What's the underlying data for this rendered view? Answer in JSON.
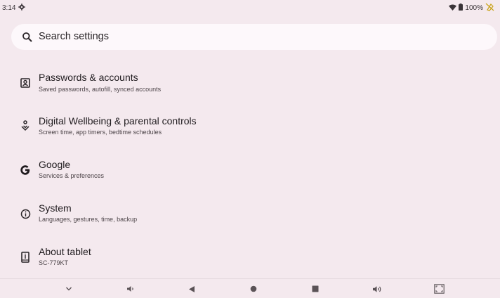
{
  "status": {
    "time": "3:14",
    "battery": "100%",
    "icons": [
      "settings-gear-icon",
      "wifi-icon",
      "battery-icon",
      "no-sim-icon"
    ]
  },
  "search": {
    "placeholder": "Search settings"
  },
  "settings": [
    {
      "title": "Passwords & accounts",
      "subtitle": "Saved passwords, autofill, synced accounts",
      "icon": "account-box-icon"
    },
    {
      "title": "Digital Wellbeing & parental controls",
      "subtitle": "Screen time, app timers, bedtime schedules",
      "icon": "wellbeing-icon"
    },
    {
      "title": "Google",
      "subtitle": "Services & preferences",
      "icon": "google-icon"
    },
    {
      "title": "System",
      "subtitle": "Languages, gestures, time, backup",
      "icon": "info-icon"
    },
    {
      "title": "About tablet",
      "subtitle": "SC-779KT",
      "icon": "tablet-icon"
    }
  ],
  "navbar": {
    "icons": [
      "chevron-down-icon",
      "volume-down-icon",
      "back-icon",
      "home-icon",
      "recents-icon",
      "volume-up-icon",
      "screenshot-icon"
    ]
  },
  "colors": {
    "background": "#f4e9ee",
    "search_bg": "#fdf8fb",
    "accent": "#c9a31a"
  }
}
